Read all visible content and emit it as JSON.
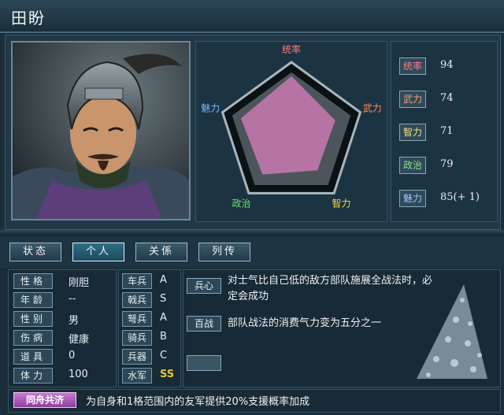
{
  "officer": {
    "name": "田盼"
  },
  "radar": {
    "labels": {
      "lead": "统率",
      "war": "武力",
      "int": "智力",
      "pol": "政治",
      "cha": "魅力"
    },
    "values": {
      "lead": 94,
      "war": 74,
      "int": 71,
      "pol": 79,
      "cha": 85
    },
    "colors": {
      "lead": "#ff7a7a",
      "war": "#ff8a4a",
      "int": "#ffd84a",
      "pol": "#6ae07a",
      "cha": "#7ab8ff"
    }
  },
  "stats": [
    {
      "label": "统率",
      "value": "94",
      "color": "#ff7a8a"
    },
    {
      "label": "武力",
      "value": "74",
      "color": "#ff9a6a"
    },
    {
      "label": "智力",
      "value": "71",
      "color": "#ffe07a"
    },
    {
      "label": "政治",
      "value": "79",
      "color": "#8ae08a"
    },
    {
      "label": "魅力",
      "value": "85(+ 1)",
      "color": "#9ac6ff"
    }
  ],
  "tabs": [
    "状态",
    "个人",
    "关係",
    "列传"
  ],
  "active_tab": 1,
  "attributes": [
    {
      "key": "性格",
      "value": "刚胆"
    },
    {
      "key": "年龄",
      "value": "--"
    },
    {
      "key": "性别",
      "value": "男"
    },
    {
      "key": "伤病",
      "value": "健康"
    },
    {
      "key": "道具",
      "value": "0"
    },
    {
      "key": "体力",
      "value": "100"
    }
  ],
  "troops": [
    {
      "key": "车兵",
      "value": "A"
    },
    {
      "key": "戟兵",
      "value": "S"
    },
    {
      "key": "弩兵",
      "value": "A"
    },
    {
      "key": "骑兵",
      "value": "B"
    },
    {
      "key": "兵器",
      "value": "C"
    },
    {
      "key": "水军",
      "value": "SS"
    }
  ],
  "skills": [
    {
      "tag": "兵心",
      "desc": "对士气比自己低的敌方部队施展全战法时，必定会成功"
    },
    {
      "tag": "百战",
      "desc": "部队战法的消费气力变为五分之一"
    },
    {
      "tag": "",
      "desc": ""
    }
  ],
  "special": {
    "tag": "同舟共济",
    "desc": "为自身和1格范围内的友军提供20%支援概率加成"
  }
}
